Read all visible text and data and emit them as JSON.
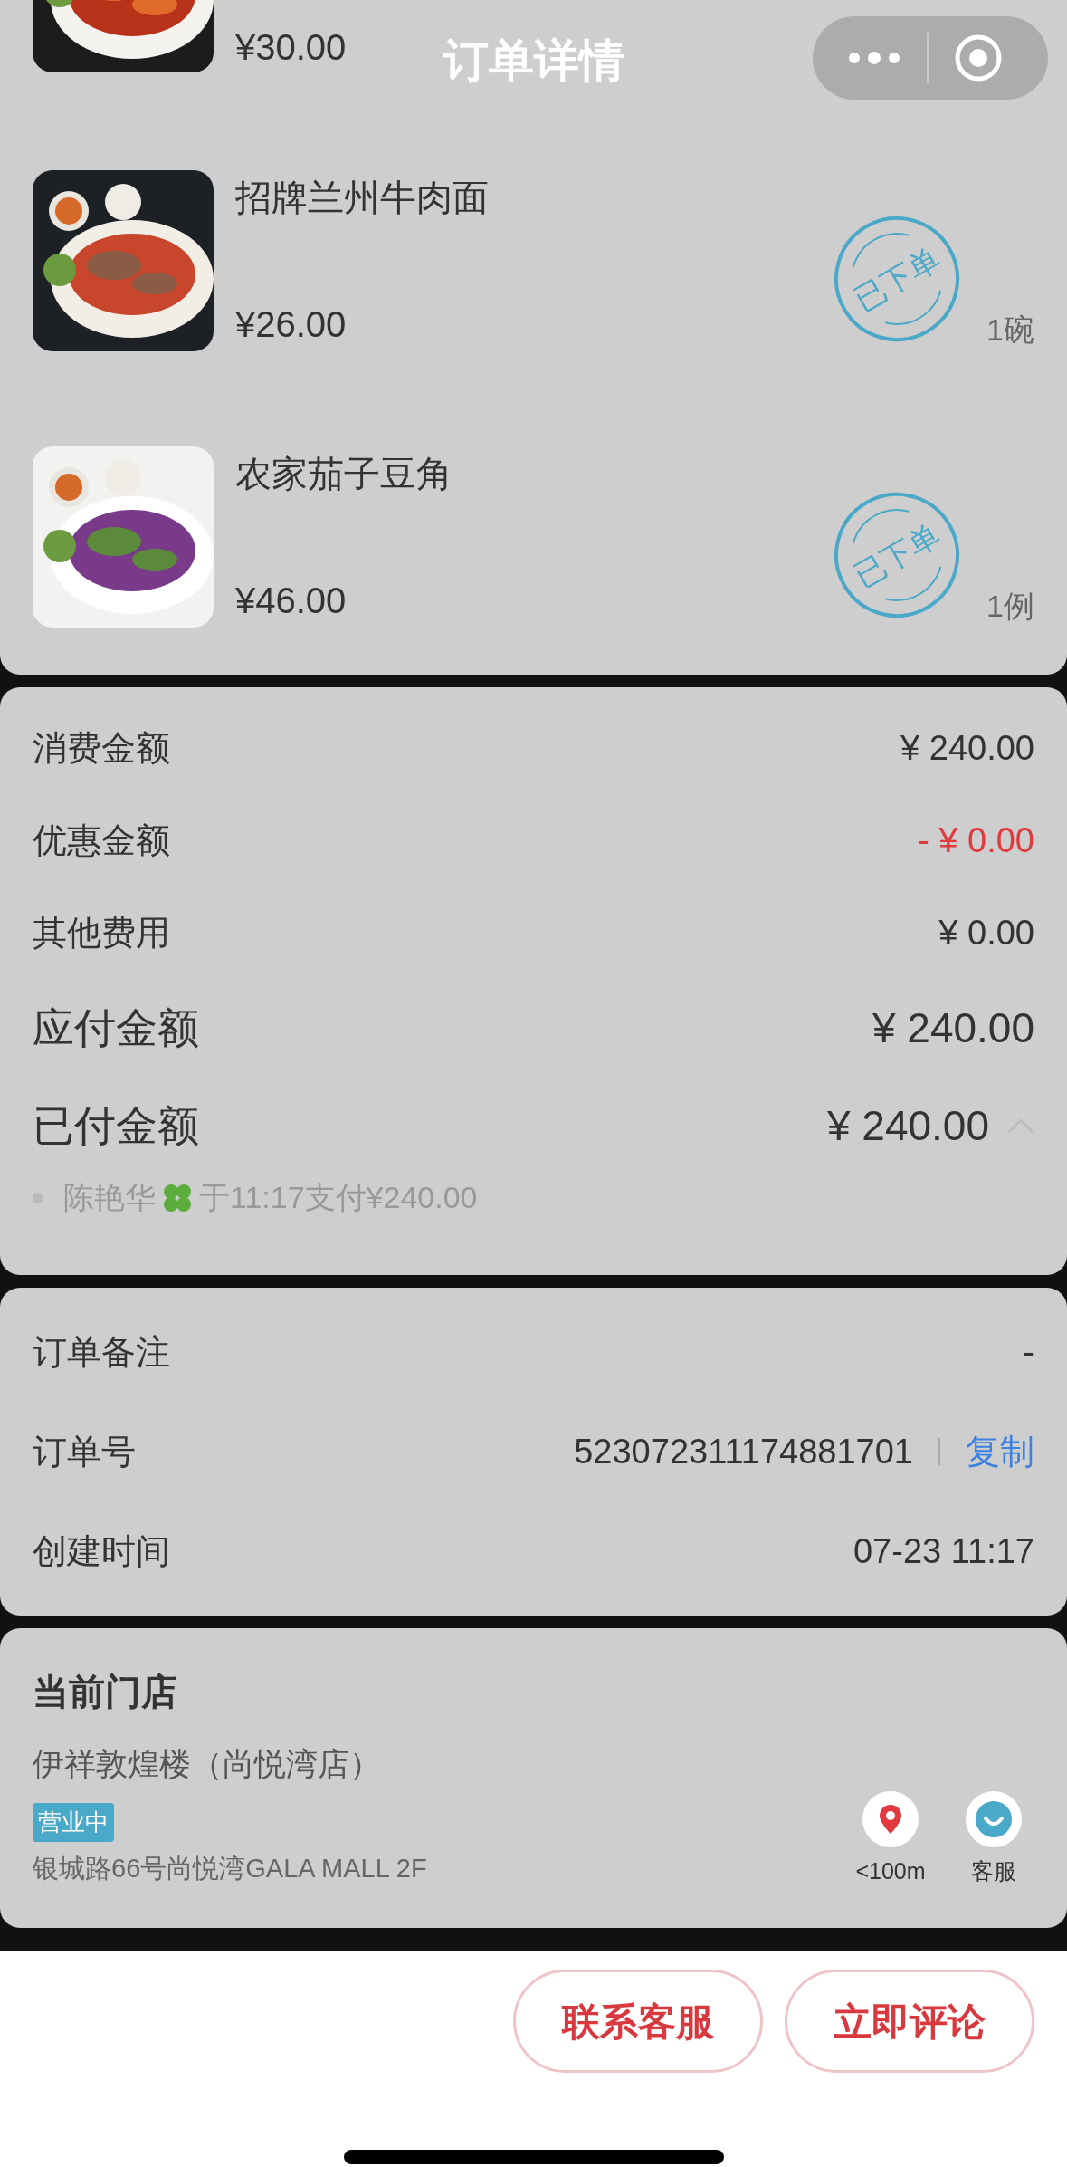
{
  "header": {
    "title": "订单详情"
  },
  "items": [
    {
      "kind": "cut",
      "price": "¥30.00"
    },
    {
      "kind": "full",
      "name": "招牌兰州牛肉面",
      "price": "¥26.00",
      "quantity": "1碗",
      "stamp": "已下单"
    },
    {
      "kind": "full",
      "name": "农家茄子豆角",
      "price": "¥46.00",
      "quantity": "1例",
      "stamp": "已下单"
    }
  ],
  "summary": [
    {
      "kind": "normal",
      "label": "消费金额",
      "value": "¥ 240.00"
    },
    {
      "kind": "discount",
      "label": "优惠金额",
      "value": "- ¥ 0.00"
    },
    {
      "kind": "normal",
      "label": "其他费用",
      "value": "¥ 0.00"
    },
    {
      "kind": "large",
      "label": "应付金额",
      "value": "¥ 240.00"
    },
    {
      "kind": "large",
      "label": "已付金额",
      "value": "¥ 240.00",
      "expanded": true
    }
  ],
  "payment": {
    "payer": "陈艳华",
    "detail": "于11:17支付¥240.00"
  },
  "order_info": [
    {
      "label": "订单备注",
      "value": "-"
    },
    {
      "label": "订单号",
      "value": "523072311174881701",
      "action": "复制"
    },
    {
      "label": "创建时间",
      "value": "07-23 11:17"
    }
  ],
  "store": {
    "title": "当前门店",
    "name": "伊祥敦煌楼（尚悦湾店）",
    "status": "营业中",
    "address": "银城路66号尚悦湾GALA MALL 2F",
    "actions": [
      {
        "kind": "location",
        "label": "<100m"
      },
      {
        "kind": "service",
        "label": "客服"
      }
    ]
  },
  "buttons": [
    "联系客服",
    "立即评论"
  ]
}
